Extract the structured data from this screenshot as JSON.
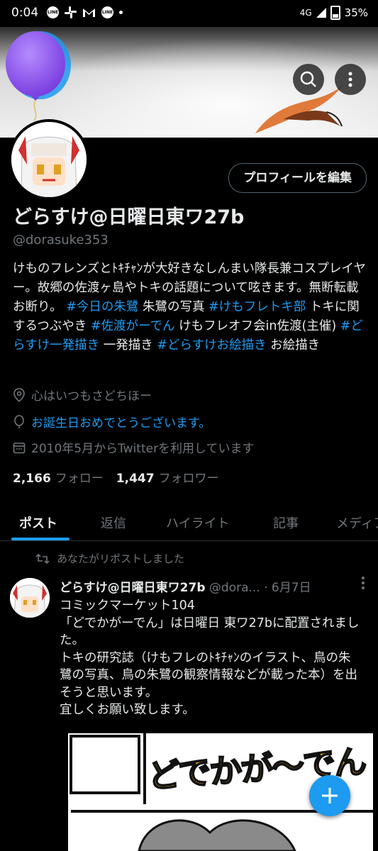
{
  "status_bar": {
    "time": "0:04",
    "notif_icons": [
      "line-icon",
      "slack-icon",
      "gmail-icon",
      "line-icon",
      "dot-icon"
    ],
    "network": "4G",
    "battery": "35%"
  },
  "header": {
    "search_icon": "search-icon",
    "more_icon": "more-vertical-icon"
  },
  "profile": {
    "edit_button": "プロフィールを編集",
    "display_name": "どらすけ@日曜日東ワ27b",
    "handle": "@dorasuke353",
    "bio_parts": [
      {
        "text": "けものフレンズとﾄｷﾁｬﾝが大好きなしんまい隊長兼コスプレイヤー。故郷の佐渡ヶ島やトキの話題について呟きます。無断転載お断り。 ",
        "tag": false
      },
      {
        "text": "#今日の朱鷺",
        "tag": true
      },
      {
        "text": " 朱鷺の写真 ",
        "tag": false
      },
      {
        "text": "#けもフレトキ部",
        "tag": true
      },
      {
        "text": " トキに関するつぶやき ",
        "tag": false
      },
      {
        "text": "#佐渡がーでん",
        "tag": true
      },
      {
        "text": " けもフレオフ会in佐渡(主催) ",
        "tag": false
      },
      {
        "text": "#どらすけ一発描き",
        "tag": true
      },
      {
        "text": " 一発描き ",
        "tag": false
      },
      {
        "text": "#どらすけお絵描き",
        "tag": true
      },
      {
        "text": " お絵描き",
        "tag": false
      }
    ],
    "location": "心はいつもさどちほー",
    "birthday": "お誕生日おめでとうございます。",
    "joined": "2010年5月からTwitterを利用しています",
    "following_count": "2,166",
    "following_label": "フォロー",
    "followers_count": "1,447",
    "followers_label": "フォロワー"
  },
  "tabs": [
    {
      "label": "ポスト",
      "active": true
    },
    {
      "label": "返信"
    },
    {
      "label": "ハイライト"
    },
    {
      "label": "記事"
    },
    {
      "label": "メディア"
    }
  ],
  "post": {
    "repost_label": "あなたがリポストしました",
    "author_name": "どらすけ@日曜日東ワ27b",
    "author_handle": "@dora...",
    "date": "· 6月7日",
    "text": "コミックマーケット104\n「どでかがーでん」は日曜日 東ワ27bに配置されました。\nトキの研究誌（けもフレのﾄｷﾁｬﾝのイラスト、鳥の朱鷺の写真、鳥の朱鷺の観察情報などが載った本）を出そうと思います。\n宜しくお願い致します。",
    "media_title": "どでかが〜でん"
  },
  "fab_icon": "plus-icon",
  "colors": {
    "accent": "#1d9bf0",
    "background": "#000000",
    "muted": "#71767b",
    "text": "#e7e9ea"
  }
}
